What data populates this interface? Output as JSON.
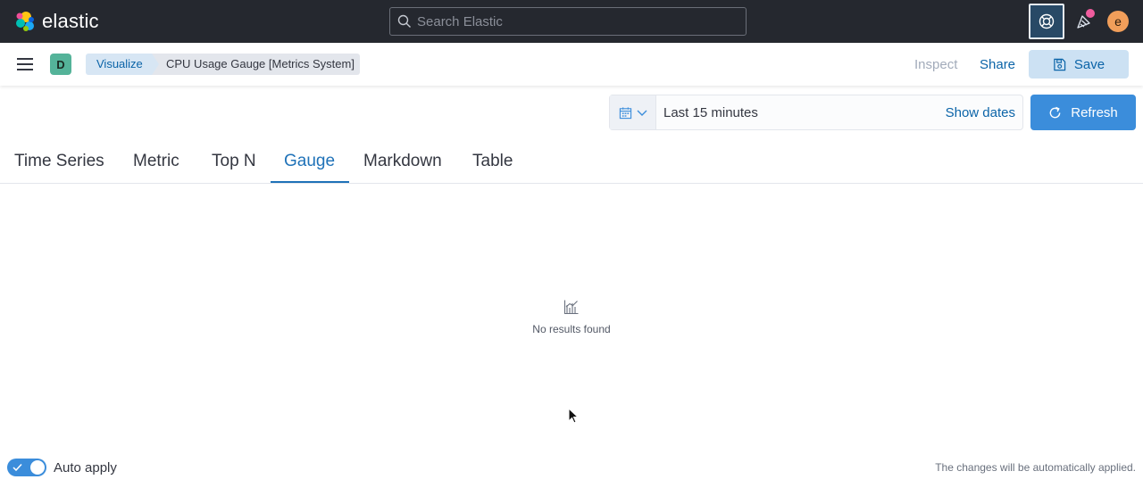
{
  "header": {
    "brand": "elastic",
    "search_placeholder": "Search Elastic",
    "user_initial": "e"
  },
  "subheader": {
    "space_initial": "D",
    "breadcrumbs": [
      "Visualize",
      "CPU Usage Gauge [Metrics System]"
    ],
    "inspect_label": "Inspect",
    "share_label": "Share",
    "save_label": "Save"
  },
  "timepicker": {
    "range_label": "Last 15 minutes",
    "show_dates_label": "Show dates",
    "refresh_label": "Refresh"
  },
  "tabs": [
    {
      "label": "Time Series",
      "active": false
    },
    {
      "label": "Metric",
      "active": false
    },
    {
      "label": "Top N",
      "active": false
    },
    {
      "label": "Gauge",
      "active": true
    },
    {
      "label": "Markdown",
      "active": false
    },
    {
      "label": "Table",
      "active": false
    }
  ],
  "empty_state": {
    "message": "No results found"
  },
  "footer": {
    "auto_apply_label": "Auto apply",
    "auto_apply_enabled": true,
    "note": "The changes will be automatically applied."
  },
  "colors": {
    "header_bg": "#25282f",
    "primary": "#3b8ddb",
    "link": "#0b64a8",
    "active_tab": "#1f72b8"
  },
  "icons": [
    "elastic-logo-icon",
    "search-icon",
    "help-icon",
    "newsfeed-icon",
    "menu-icon",
    "save-icon",
    "calendar-icon",
    "chevron-down-icon",
    "refresh-icon",
    "visualize-app-icon",
    "check-icon",
    "cursor-icon"
  ]
}
